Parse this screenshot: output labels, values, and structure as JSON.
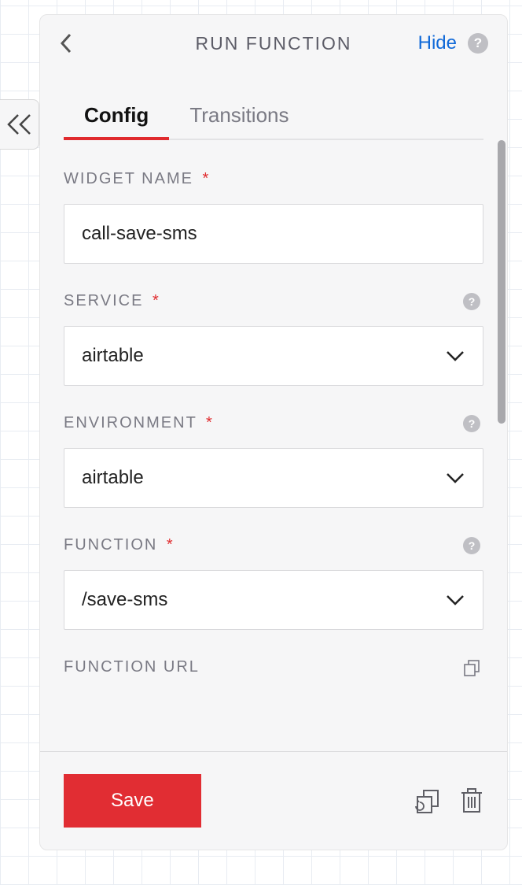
{
  "header": {
    "title": "RUN FUNCTION",
    "hide_label": "Hide"
  },
  "tabs": {
    "config": "Config",
    "transitions": "Transitions"
  },
  "form": {
    "widget_name": {
      "label": "WIDGET NAME",
      "value": "call-save-sms",
      "required": "*"
    },
    "service": {
      "label": "SERVICE",
      "value": "airtable",
      "required": "*"
    },
    "environment": {
      "label": "ENVIRONMENT",
      "value": "airtable",
      "required": "*"
    },
    "function": {
      "label": "FUNCTION",
      "value": "/save-sms",
      "required": "*"
    },
    "function_url": {
      "label": "FUNCTION URL"
    }
  },
  "footer": {
    "save_label": "Save"
  }
}
